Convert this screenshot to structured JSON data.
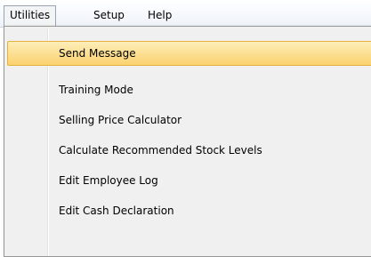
{
  "menubar": {
    "items": [
      {
        "label": "Utilities",
        "open": true
      },
      {
        "label": "Setup"
      },
      {
        "label": "Help"
      }
    ]
  },
  "utilities_menu": {
    "items": [
      {
        "label": "Send Message",
        "highlighted": true
      },
      {
        "label": "Training Mode"
      },
      {
        "label": "Selling Price Calculator"
      },
      {
        "label": "Calculate Recommended Stock Levels"
      },
      {
        "label": "Edit Employee Log"
      },
      {
        "label": "Edit Cash Declaration"
      }
    ]
  },
  "colors": {
    "highlight_top": "#fdeeb9",
    "highlight_bottom": "#fbd26f",
    "highlight_border": "#e5b23d",
    "menu_background": "#f0f0f0"
  }
}
